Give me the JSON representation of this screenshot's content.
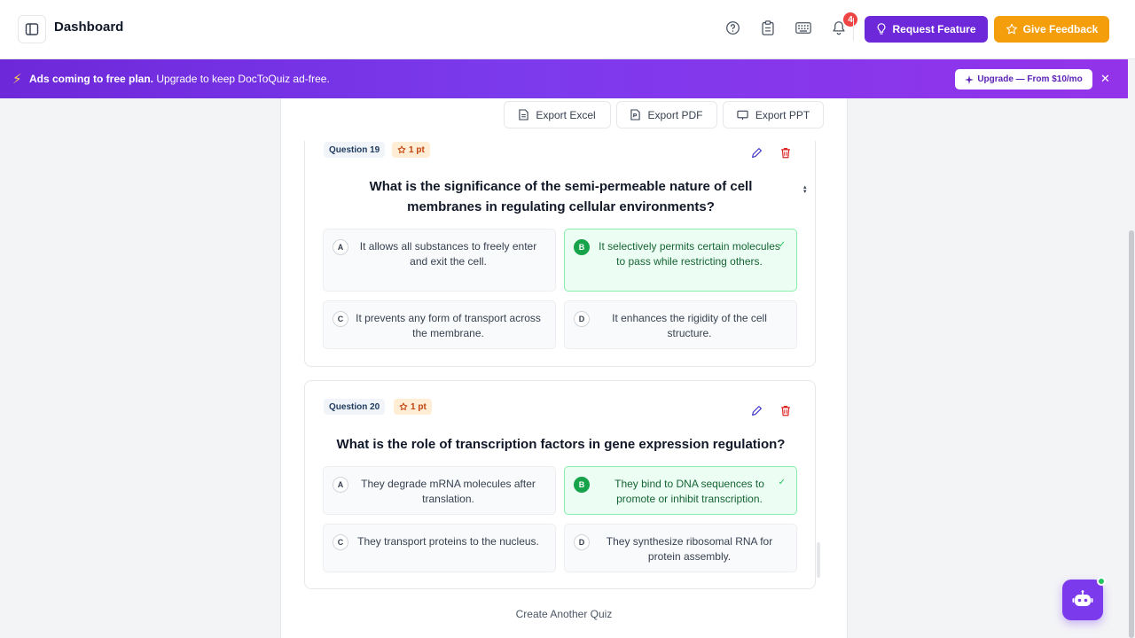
{
  "header": {
    "title": "Dashboard",
    "notification_count": "4",
    "request_feature_label": "Request Feature",
    "give_feedback_label": "Give Feedback"
  },
  "banner": {
    "bold_text": "Ads coming to free plan.",
    "text": " Upgrade to keep DocToQuiz ad-free.",
    "upgrade_label": "Upgrade — From $10/mo"
  },
  "toolbar": {
    "export_excel": "Export Excel",
    "export_pdf": "Export PDF",
    "export_ppt": "Export PPT"
  },
  "questions": [
    {
      "label": "Question 19",
      "points": "1 pt",
      "text": "What is the significance of the semi-permeable nature of cell membranes in regulating cellular environments?",
      "options": [
        {
          "letter": "A",
          "text": "It allows all substances to freely enter and exit the cell.",
          "correct": false
        },
        {
          "letter": "B",
          "text": "It selectively permits certain molecules to pass while restricting others.",
          "correct": true
        },
        {
          "letter": "C",
          "text": "It prevents any form of transport across the membrane.",
          "correct": false
        },
        {
          "letter": "D",
          "text": "It enhances the rigidity of the cell structure.",
          "correct": false
        }
      ]
    },
    {
      "label": "Question 20",
      "points": "1 pt",
      "text": "What is the role of transcription factors in gene expression regulation?",
      "options": [
        {
          "letter": "A",
          "text": "They degrade mRNA molecules after translation.",
          "correct": false
        },
        {
          "letter": "B",
          "text": "They bind to DNA sequences to promote or inhibit transcription.",
          "correct": true
        },
        {
          "letter": "C",
          "text": "They transport proteins to the nucleus.",
          "correct": false
        },
        {
          "letter": "D",
          "text": "They synthesize ribosomal RNA for protein assembly.",
          "correct": false
        }
      ]
    }
  ],
  "footer": {
    "create_another": "Create Another Quiz"
  },
  "colors": {
    "accent": "#6d28d9",
    "feedback": "#f59e0b",
    "correct": "#16a34a",
    "danger": "#dc2626"
  },
  "icons": [
    "sidebar-toggle-icon",
    "help-icon",
    "clipboard-icon",
    "keyboard-icon",
    "bell-icon",
    "lightbulb-icon",
    "star-icon",
    "bolt-icon",
    "sparkle-icon",
    "close-icon",
    "file-excel-icon",
    "file-pdf-icon",
    "presentation-icon",
    "pencil-icon",
    "trash-icon",
    "check-icon",
    "bot-icon"
  ]
}
